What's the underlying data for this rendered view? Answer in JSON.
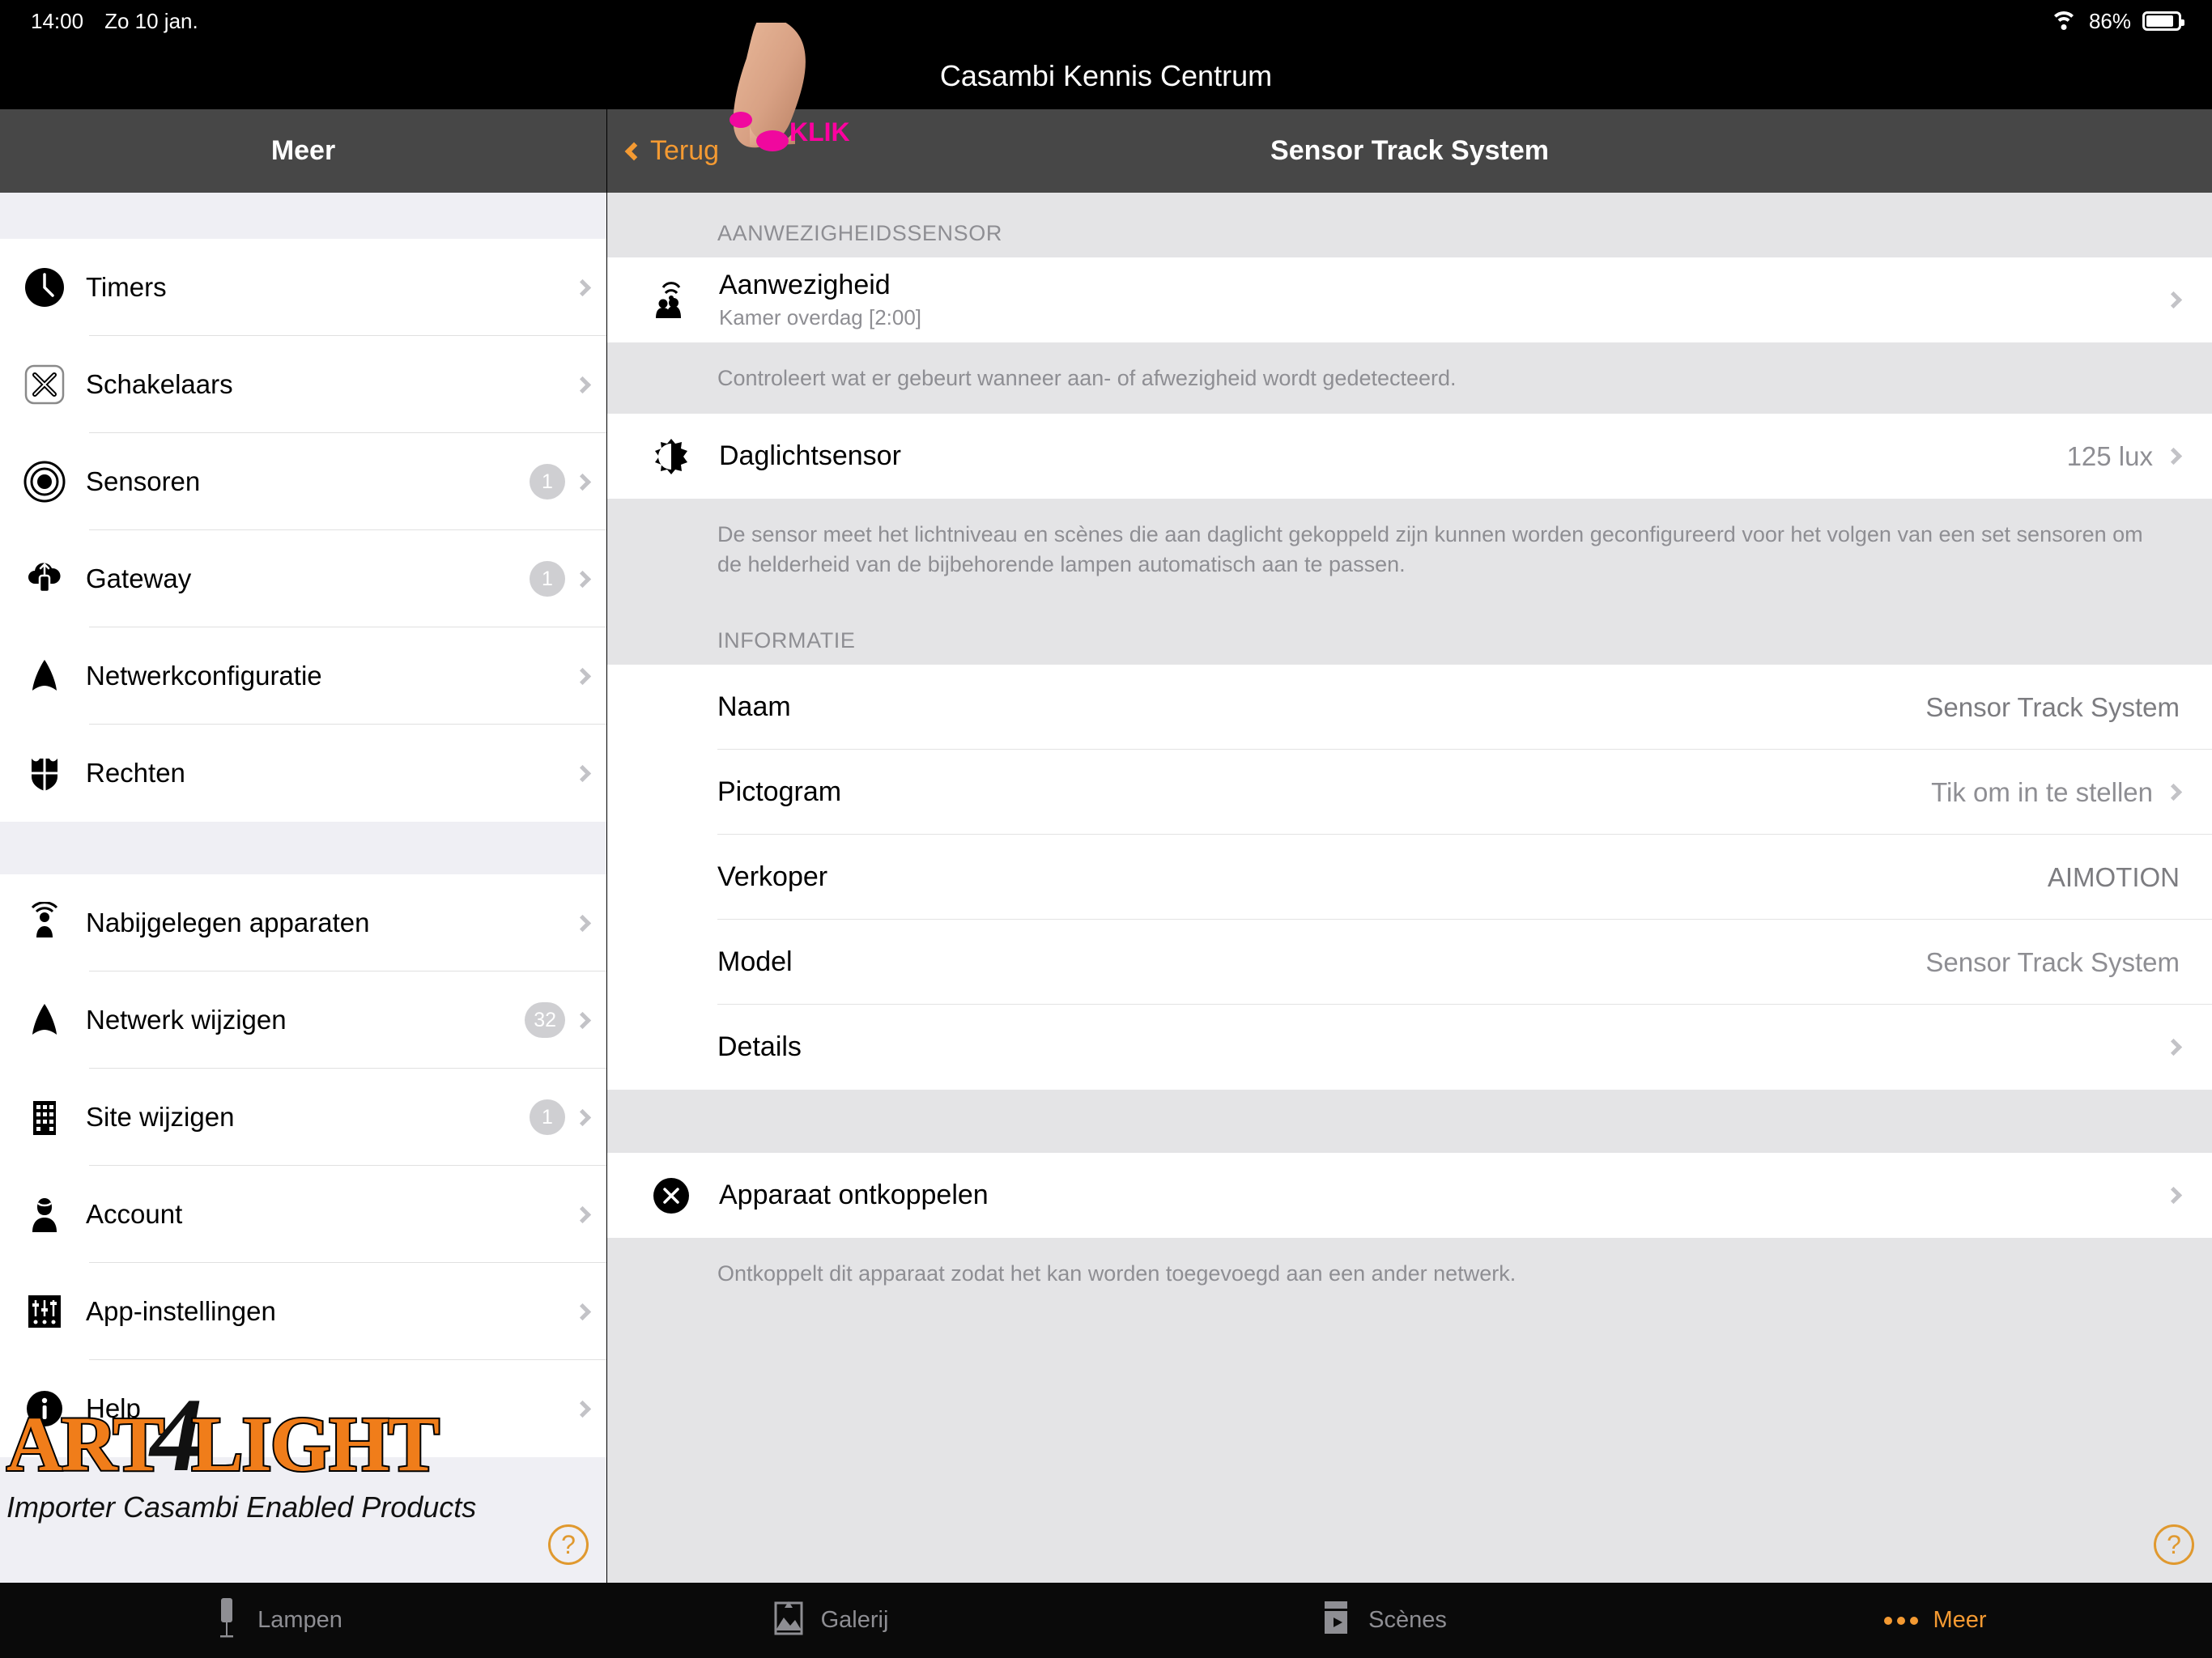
{
  "statusbar": {
    "time": "14:00",
    "date": "Zo 10 jan.",
    "battery_percent": "86%",
    "wifi_icon": "wifi-icon",
    "battery_icon": "battery-icon"
  },
  "app": {
    "title": "Casambi Kennis Centrum"
  },
  "nav": {
    "left_title": "Meer",
    "back_label": "Terug",
    "right_title": "Sensor Track System"
  },
  "annotation": {
    "klik_label": "KLIK"
  },
  "sidebar": {
    "group1": [
      {
        "label": "Timers",
        "icon": "clock-icon",
        "badge": ""
      },
      {
        "label": "Schakelaars",
        "icon": "switch-icon",
        "badge": ""
      },
      {
        "label": "Sensoren",
        "icon": "sensor-icon",
        "badge": "1"
      },
      {
        "label": "Gateway",
        "icon": "cloud-upload-icon",
        "badge": "1"
      },
      {
        "label": "Netwerkconfiguratie",
        "icon": "network-icon",
        "badge": ""
      },
      {
        "label": "Rechten",
        "icon": "shield-icon",
        "badge": ""
      }
    ],
    "group2": [
      {
        "label": "Nabijgelegen apparaten",
        "icon": "broadcast-person-icon",
        "badge": ""
      },
      {
        "label": "Netwerk wijzigen",
        "icon": "network-icon",
        "badge": "32"
      },
      {
        "label": "Site wijzigen",
        "icon": "building-icon",
        "badge": "1"
      },
      {
        "label": "Account",
        "icon": "person-icon",
        "badge": ""
      },
      {
        "label": "App-instellingen",
        "icon": "sliders-icon",
        "badge": ""
      },
      {
        "label": "Help",
        "icon": "info-icon",
        "badge": ""
      }
    ],
    "logo": {
      "part1": "ART",
      "part2": "4",
      "part3": "LIGHT",
      "tagline": "Importer Casambi Enabled Products"
    },
    "help_button": "?"
  },
  "content": {
    "presence_section_header": "AANWEZIGHEIDSSENSOR",
    "presence_row": {
      "title": "Aanwezigheid",
      "subtitle": "Kamer overdag [2:00]",
      "icon": "presence-people-icon"
    },
    "presence_note": "Controleert wat er gebeurt wanneer aan- of afwezigheid wordt gedetecteerd.",
    "daylight_row": {
      "title": "Daglichtsensor",
      "value": "125 lux",
      "icon": "brightness-icon"
    },
    "daylight_note": "De sensor meet het lichtniveau en scènes die aan daglicht gekoppeld zijn kunnen worden geconfigureerd voor het volgen van een set sensoren om de helderheid van de bijbehorende lampen automatisch aan te passen.",
    "info_section_header": "INFORMATIE",
    "info_rows": [
      {
        "label": "Naam",
        "value": "Sensor Track System",
        "chevron": false
      },
      {
        "label": "Pictogram",
        "value": "Tik om in te stellen",
        "chevron": true
      },
      {
        "label": "Verkoper",
        "value": "AIMOTION",
        "chevron": false
      },
      {
        "label": "Model",
        "value": "Sensor Track System",
        "chevron": false
      },
      {
        "label": "Details",
        "value": "",
        "chevron": true
      }
    ],
    "unpair_row": {
      "title": "Apparaat ontkoppelen",
      "icon": "close-circle-icon"
    },
    "unpair_note": "Ontkoppelt dit apparaat zodat het kan worden toegevoegd aan een ander netwerk."
  },
  "tabbar": {
    "tabs": [
      {
        "label": "Lampen",
        "icon": "lamp-icon",
        "active": false
      },
      {
        "label": "Galerij",
        "icon": "gallery-icon",
        "active": false
      },
      {
        "label": "Scènes",
        "icon": "scenes-icon",
        "active": false
      },
      {
        "label": "Meer",
        "icon": "ellipsis-icon",
        "active": true
      }
    ]
  },
  "colors": {
    "accent": "#f49a32",
    "annotation": "#ff00a0",
    "logo_orange": "#f07d1a",
    "panel_bg": "#e4e4e6",
    "sidebar_bg": "#efeff4"
  }
}
